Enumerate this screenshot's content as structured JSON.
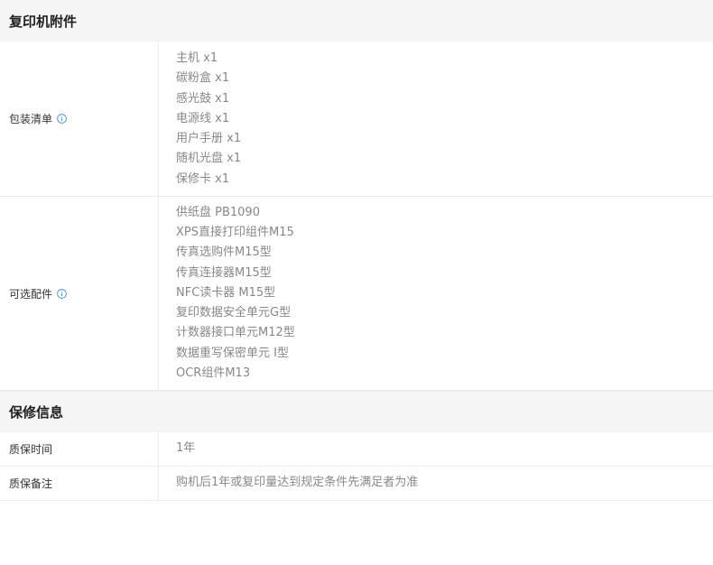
{
  "sections": [
    {
      "title": "复印机附件",
      "rows": [
        {
          "label": "包装清单",
          "has_info": true,
          "values": [
            "主机 x1",
            "碳粉盒 x1",
            "感光鼓 x1",
            "电源线 x1",
            "用户手册 x1",
            "随机光盘 x1",
            "保修卡 x1"
          ]
        },
        {
          "label": "可选配件",
          "has_info": true,
          "values": [
            "供纸盘 PB1090",
            "XPS直接打印组件M15",
            "传真选购件M15型",
            "传真连接器M15型",
            "NFC读卡器 M15型",
            "复印数据安全单元G型",
            "计数器接口单元M12型",
            "数据重写保密单元 I型",
            "OCR组件M13"
          ]
        }
      ]
    },
    {
      "title": "保修信息",
      "rows": [
        {
          "label": "质保时间",
          "has_info": false,
          "values": [
            "1年"
          ]
        },
        {
          "label": "质保备注",
          "has_info": false,
          "values": [
            "购机后1年或复印量达到规定条件先满足者为准"
          ]
        }
      ]
    }
  ],
  "colors": {
    "header_bg": "#f5f5f5",
    "border": "#ededed",
    "value_text": "#888888",
    "info_icon": "#4a90e2"
  },
  "icons": {
    "info": "info-circle-icon"
  }
}
